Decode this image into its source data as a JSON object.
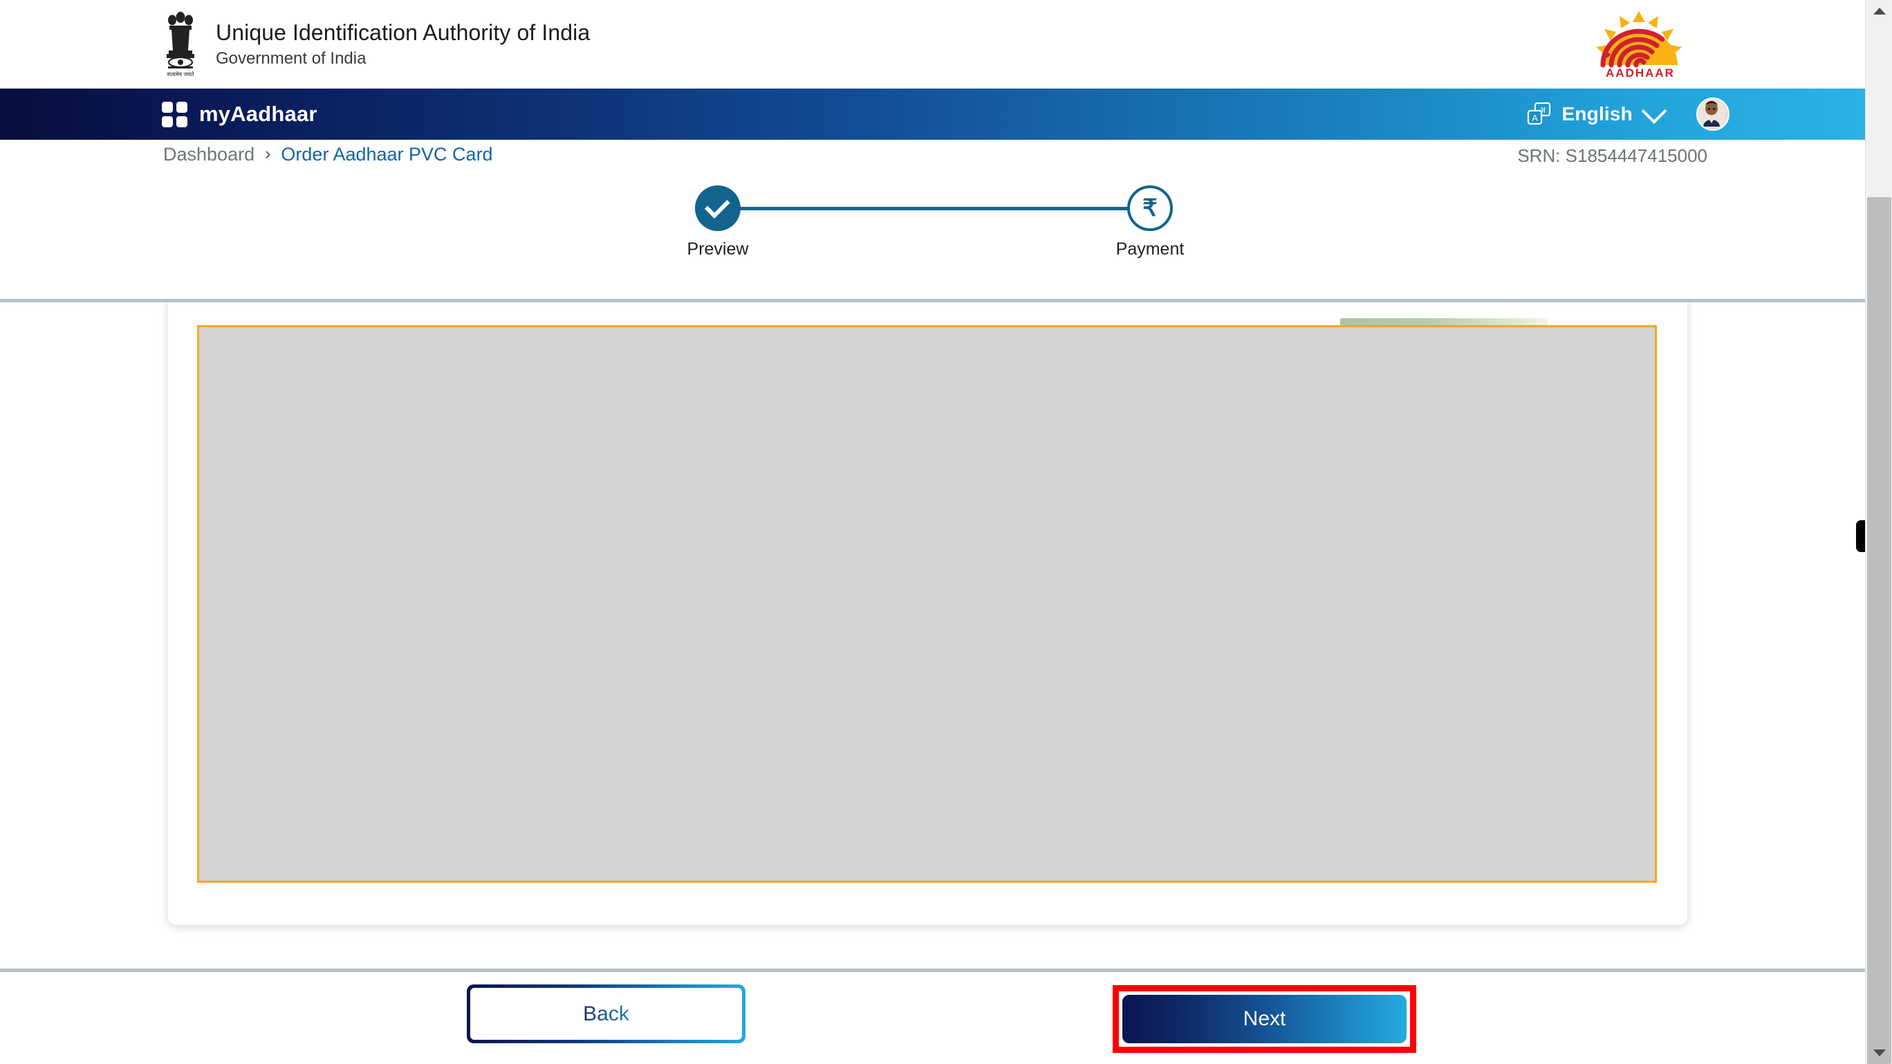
{
  "gov_header": {
    "emblem_icon": "india-state-emblem-icon",
    "title": "Unique Identification Authority of India",
    "subtitle": "Government of India",
    "brand_logo": {
      "icon": "aadhaar-sun-fingerprint-logo",
      "wordmark": "AADHAAR",
      "sun_color": "#f9b212",
      "fingerprint_color": "#cf2030"
    }
  },
  "navbar": {
    "grid_icon": "four-square-grid-icon",
    "brand": "myAadhaar",
    "language": {
      "icon": "language-translate-icon",
      "latin_glyph": "A",
      "devanagari_glyph": "अ",
      "label": "English",
      "chevron_icon": "chevron-down-icon"
    },
    "avatar_icon": "user-avatar-photo",
    "gradient_start": "#070f3d",
    "gradient_end": "#29b2e5"
  },
  "breadcrumb": {
    "home": "Dashboard",
    "separator": "›",
    "current": "Order Aadhaar PVC Card"
  },
  "srn": {
    "text": "SRN: S1854447415000"
  },
  "stepper": {
    "steps": [
      {
        "label": "Preview",
        "state": "completed",
        "icon": "check-icon"
      },
      {
        "label": "Payment",
        "state": "pending",
        "icon": "rupee-icon",
        "glyph": "₹"
      }
    ],
    "accent_color": "#12648f"
  },
  "main": {
    "preview": {
      "name": "aadhaar-pvc-card-preview",
      "border_color": "#f5a623",
      "fill_color": "#d3d3d3"
    }
  },
  "footer": {
    "back_label": "Back",
    "next_label": "Next",
    "highlight_color": "#ff0000"
  },
  "scrollbar": {
    "up_icon": "scroll-up-arrow-icon",
    "down_icon": "scroll-down-arrow-icon"
  },
  "edge_handle": {
    "icon": "panel-toggle-handle-icon"
  }
}
